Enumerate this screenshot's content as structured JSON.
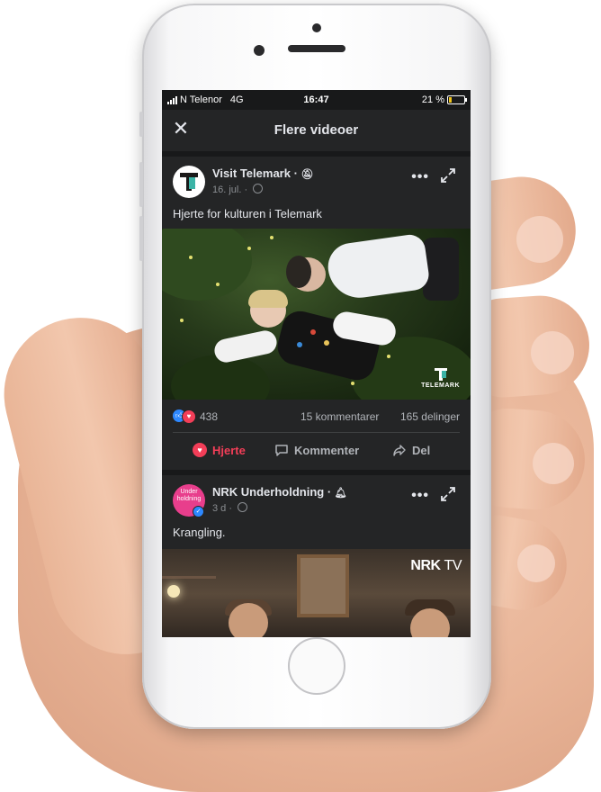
{
  "status_bar": {
    "carrier": "N Telenor",
    "network": "4G",
    "time": "16:47",
    "battery_text": "21 %",
    "battery_level": 0.21
  },
  "header": {
    "title": "Flere videoer",
    "close_icon": "close-icon"
  },
  "posts": [
    {
      "page_name": "Visit Telemark · ",
      "name_icon": "bell-off-icon",
      "date": "16. jul. · ",
      "caption": "Hjerte for kulturen i Telemark",
      "video_logo": "TELEMARK",
      "reaction_count": "438",
      "comments": "15 kommentarer",
      "shares": "165 delinger",
      "actions": {
        "heart": "Hjerte",
        "comment": "Kommenter",
        "share": "Del"
      }
    },
    {
      "page_name": "NRK Underholdning · ",
      "name_icon": "bell-icon",
      "avatar_text": "Under holdning",
      "date": "3 d · ",
      "caption": "Krangling.",
      "video_logo": "NRK",
      "video_logo_suffix": "TV"
    }
  ],
  "colors": {
    "background": "#18191a",
    "card": "#242526",
    "like_blue": "#2d88ff",
    "heart_red": "#f33e58"
  }
}
